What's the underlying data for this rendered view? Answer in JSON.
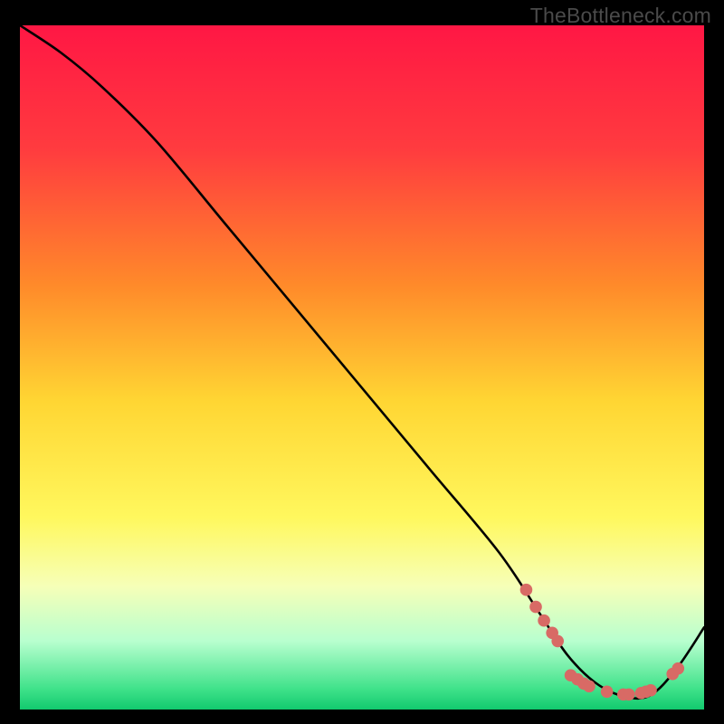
{
  "watermark": "TheBottleneck.com",
  "chart_data": {
    "type": "line",
    "title": "",
    "xlabel": "",
    "ylabel": "",
    "xlim": [
      0,
      100
    ],
    "ylim": [
      0,
      100
    ],
    "gradient_stops": [
      {
        "offset": 0,
        "color": "#ff1744"
      },
      {
        "offset": 18,
        "color": "#ff3b3f"
      },
      {
        "offset": 38,
        "color": "#ff8a2a"
      },
      {
        "offset": 55,
        "color": "#ffd633"
      },
      {
        "offset": 72,
        "color": "#fff85e"
      },
      {
        "offset": 82,
        "color": "#f6ffb8"
      },
      {
        "offset": 90,
        "color": "#b8ffcf"
      },
      {
        "offset": 97,
        "color": "#3fe28a"
      },
      {
        "offset": 100,
        "color": "#12c96e"
      }
    ],
    "series": [
      {
        "name": "bottleneck-curve",
        "color": "#000000",
        "x": [
          0,
          6,
          12,
          20,
          30,
          40,
          50,
          60,
          70,
          76,
          80,
          84,
          88,
          92,
          96,
          100
        ],
        "y": [
          100,
          96,
          91,
          83,
          71,
          59,
          47,
          35,
          23,
          14,
          8,
          4,
          2,
          2,
          6,
          12
        ]
      }
    ],
    "markers": {
      "name": "highlight-dots",
      "color": "#d86a65",
      "radius": 6.8,
      "points": [
        {
          "x": 74.0,
          "y": 17.5
        },
        {
          "x": 75.4,
          "y": 15.0
        },
        {
          "x": 76.6,
          "y": 13.0
        },
        {
          "x": 77.8,
          "y": 11.2
        },
        {
          "x": 78.6,
          "y": 10.0
        },
        {
          "x": 80.5,
          "y": 5.0
        },
        {
          "x": 81.5,
          "y": 4.4
        },
        {
          "x": 82.4,
          "y": 3.8
        },
        {
          "x": 83.2,
          "y": 3.4
        },
        {
          "x": 85.8,
          "y": 2.6
        },
        {
          "x": 88.2,
          "y": 2.2
        },
        {
          "x": 89.0,
          "y": 2.2
        },
        {
          "x": 90.8,
          "y": 2.4
        },
        {
          "x": 91.5,
          "y": 2.6
        },
        {
          "x": 92.2,
          "y": 2.8
        },
        {
          "x": 95.4,
          "y": 5.2
        },
        {
          "x": 96.2,
          "y": 6.0
        }
      ]
    }
  }
}
